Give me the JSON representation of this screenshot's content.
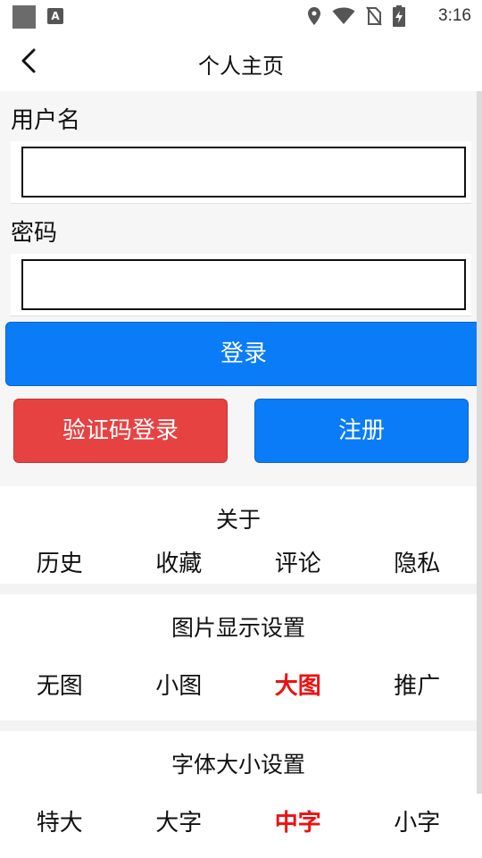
{
  "status_bar": {
    "time": "3:16",
    "app_badge": "A",
    "icons": [
      "location-icon",
      "wifi-icon",
      "no-sim-icon",
      "battery-charging-icon"
    ]
  },
  "header": {
    "title": "个人主页",
    "back_icon": "chevron-left-icon"
  },
  "login": {
    "username_label": "用户名",
    "username_value": "",
    "password_label": "密码",
    "password_value": "",
    "login_button": "登录",
    "code_login_button": "验证码登录",
    "register_button": "注册"
  },
  "colors": {
    "primary": "#0a7cf8",
    "danger": "#e74242",
    "active_option": "#ee1111"
  },
  "about": {
    "title": "关于",
    "items": [
      "历史",
      "收藏",
      "评论",
      "隐私"
    ]
  },
  "image_settings": {
    "title": "图片显示设置",
    "options": [
      "无图",
      "小图",
      "大图",
      "推广"
    ],
    "selected": "大图"
  },
  "font_settings": {
    "title": "字体大小设置",
    "options": [
      "特大",
      "大字",
      "中字",
      "小字"
    ],
    "selected": "中字"
  }
}
